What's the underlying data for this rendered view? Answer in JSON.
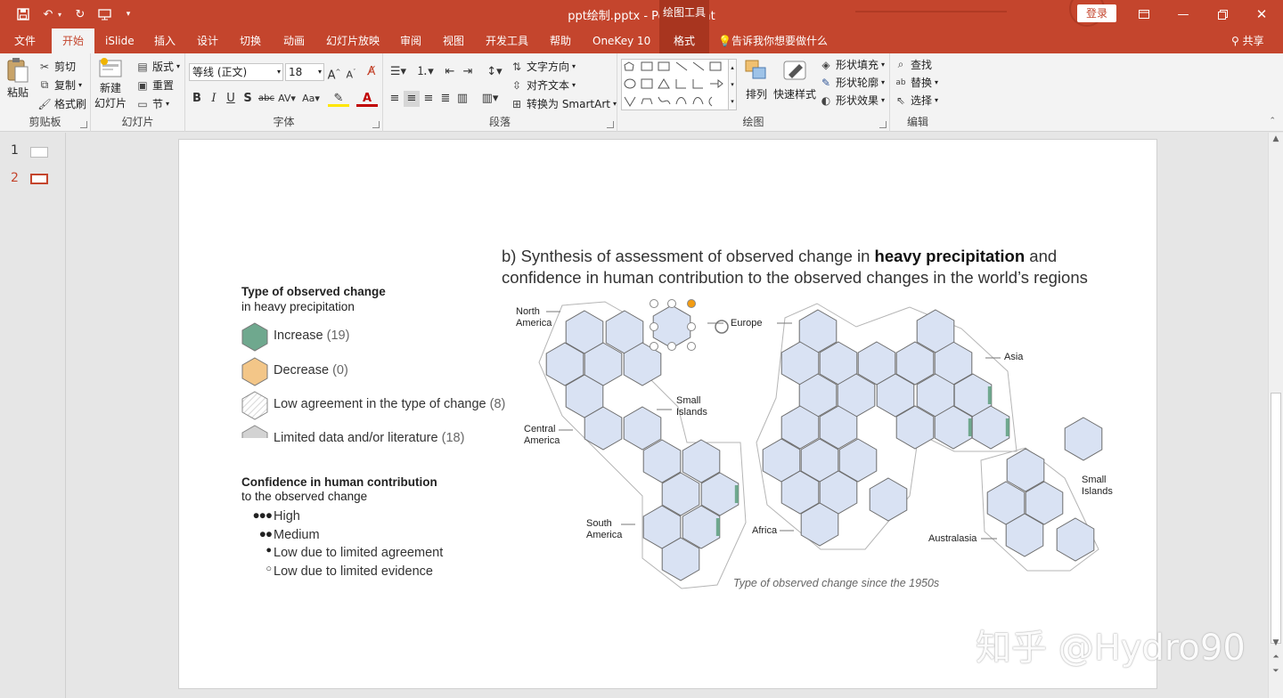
{
  "titlebar": {
    "doc_title": "ppt绘制.pptx  -  PowerPoint",
    "context_tools": "绘图工具",
    "login": "登录",
    "icons": [
      "save-icon",
      "undo-icon",
      "redo-icon",
      "present-icon",
      "customize-icon"
    ]
  },
  "tabs": [
    {
      "label": "文件"
    },
    {
      "label": "开始"
    },
    {
      "label": "iSlide"
    },
    {
      "label": "插入"
    },
    {
      "label": "设计"
    },
    {
      "label": "切换"
    },
    {
      "label": "动画"
    },
    {
      "label": "幻灯片放映"
    },
    {
      "label": "审阅"
    },
    {
      "label": "视图"
    },
    {
      "label": "开发工具"
    },
    {
      "label": "帮助"
    },
    {
      "label": "OneKey 10"
    },
    {
      "label": "格式"
    }
  ],
  "tell_me": "告诉我你想要做什么",
  "share": "共享",
  "ribbon": {
    "clipboard": {
      "paste": "粘贴",
      "cut": "剪切",
      "copy": "复制",
      "format_painter": "格式刷",
      "label": "剪贴板"
    },
    "slides": {
      "new_slide": "新建",
      "new_slide2": "幻灯片",
      "layout": "版式",
      "reset": "重置",
      "section": "节",
      "label": "幻灯片"
    },
    "font": {
      "font_name": "等线 (正文)",
      "font_size": "18",
      "label": "字体"
    },
    "paragraph": {
      "text_direction": "文字方向",
      "align_text": "对齐文本",
      "smartart": "转换为 SmartArt",
      "label": "段落"
    },
    "drawing": {
      "arrange": "排列",
      "quick_styles": "快速样式",
      "shape_fill": "形状填充",
      "shape_outline": "形状轮廓",
      "shape_effects": "形状效果",
      "label": "绘图"
    },
    "editing": {
      "find": "查找",
      "replace": "替换",
      "select": "选择",
      "label": "编辑"
    }
  },
  "thumbnails": [
    {
      "num": "1"
    },
    {
      "num": "2"
    }
  ],
  "slide": {
    "title_pre": "b) Synthesis of assessment of observed change in ",
    "title_bold": "heavy precipitation",
    "title_post": " and",
    "title_line2": "confidence in human contribution to the observed changes in the world’s regions",
    "legend_heading": "Type of observed change",
    "legend_sub": "in heavy precipitation",
    "legend_items": [
      {
        "label": "Increase",
        "count": "(19)",
        "color": "#6fa88e"
      },
      {
        "label": "Decrease",
        "count": "(0)",
        "color": "#f3c688"
      },
      {
        "label": "Low agreement in the type of change",
        "count": "(8)",
        "color": "#ffffff"
      },
      {
        "label": "Limited data and/or literature",
        "count": "(18)",
        "color": "#d3d3d3"
      }
    ],
    "confidence_heading": "Confidence in human contribution",
    "confidence_sub": "to the observed change",
    "confidence_items": [
      {
        "dots": "●●●",
        "label": "High"
      },
      {
        "dots": "●●",
        "label": "Medium"
      },
      {
        "dots": "●",
        "label": "Low due to limited agreement"
      },
      {
        "dots": "○",
        "label": "Low due to limited evidence"
      }
    ],
    "regions": {
      "north_america_1": "North",
      "north_america_2": "America",
      "europe": "Europe",
      "asia": "Asia",
      "small_islands_1": "Small",
      "small_islands_2": "Islands",
      "central_america_1": "Central",
      "central_america_2": "America",
      "south_america_1": "South",
      "south_america_2": "America",
      "africa": "Africa",
      "australasia": "Australasia",
      "small_islands_b1": "Small",
      "small_islands_b2": "Islands"
    },
    "caption": "Type of observed change since the 1950s",
    "hex_fill": "#d9e2f3"
  },
  "watermark": "知乎 @Hydro90"
}
